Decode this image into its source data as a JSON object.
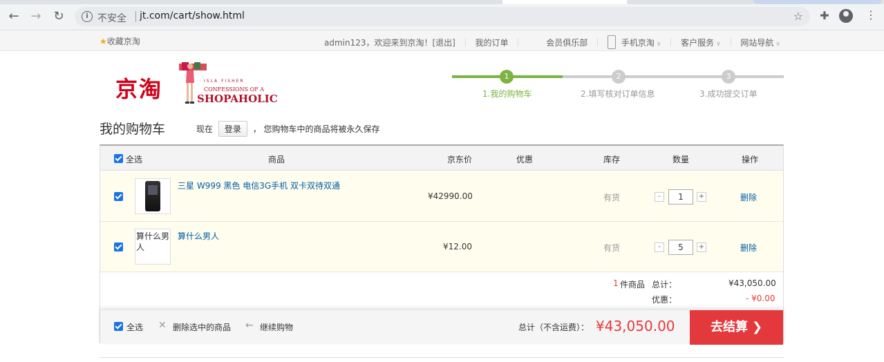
{
  "browser": {
    "insecure_label": "不安全",
    "url": "jt.com/cart/show.html"
  },
  "topbar": {
    "favorite": "收藏京淘",
    "welcome": "admin123，欢迎来到京淘！[退出]",
    "my_orders": "我的订单",
    "member_club": "会员俱乐部",
    "mobile": "手机京淘",
    "customer_service": "客户服务",
    "site_nav": "网站导航"
  },
  "logo": {
    "cn_text": "京淘",
    "line1": "ISLA FISHER",
    "line2": "CONFESSIONS OF A",
    "line3": "SHOPAHOLIC"
  },
  "steps": [
    {
      "num": "1",
      "label": "1.我的购物车",
      "active": true
    },
    {
      "num": "2",
      "label": "2.填写核对订单信息",
      "active": false
    },
    {
      "num": "3",
      "label": "3.成功提交订单",
      "active": false
    }
  ],
  "page": {
    "title": "我的购物车",
    "tip_prefix": "现在",
    "login_button": "登录",
    "tip_suffix": "，  您购物车中的商品将被永久保存"
  },
  "table": {
    "headers": {
      "select_all": "全选",
      "product": "商品",
      "price": "京东价",
      "discount": "优惠",
      "stock": "库存",
      "quantity": "数量",
      "action": "操作"
    },
    "rows": [
      {
        "name": "三星 W999 黑色 电信3G手机 双卡双待双通",
        "price": "¥42990.00",
        "stock": "有货",
        "qty": "1",
        "delete": "删除",
        "image_alt": ""
      },
      {
        "name": "算什么男人",
        "price": "¥12.00",
        "stock": "有货",
        "qty": "5",
        "delete": "删除",
        "image_alt": "算什么男人"
      }
    ],
    "qty_minus": "-",
    "qty_plus": "+"
  },
  "summary": {
    "count": "1",
    "count_unit": "件商品",
    "total_label": "总计：",
    "total_value": "¥43,050.00",
    "discount_label": "优惠：",
    "discount_value": "- ¥0.00"
  },
  "footer": {
    "select_all": "全选",
    "delete_selected": "删除选中的商品",
    "continue_shopping": "继续购物",
    "total_label": "总计（不含运费）：",
    "total_value": "¥43,050.00",
    "checkout_button": "去结算"
  },
  "colors": {
    "accent_green": "#7cb342",
    "price_red": "#e4393c",
    "link_blue": "#005ea7"
  }
}
